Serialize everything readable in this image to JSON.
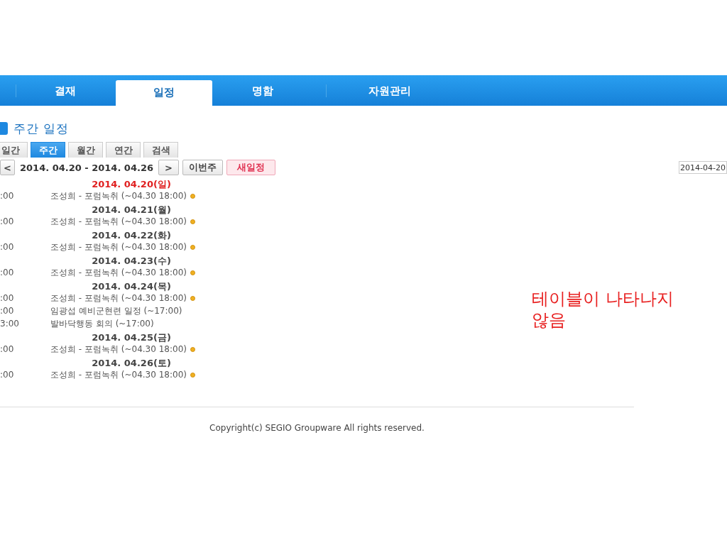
{
  "nav_tabs": [
    {
      "label": "결재",
      "selected": false
    },
    {
      "label": "일정",
      "selected": true
    },
    {
      "label": "명함",
      "selected": false
    },
    {
      "label": "자원관리",
      "selected": false
    }
  ],
  "section_title": "주간 일정",
  "view_tabs": [
    {
      "label": "일간",
      "selected": false
    },
    {
      "label": "주간",
      "selected": true
    },
    {
      "label": "월간",
      "selected": false
    },
    {
      "label": "연간",
      "selected": false
    },
    {
      "label": "검색",
      "selected": false
    }
  ],
  "toolbar": {
    "prev": "<",
    "range": "2014. 04.20 - 2014. 04.26",
    "next": ">",
    "this_week": "이번주",
    "new_event": "새일정",
    "date_value": "2014-04-20"
  },
  "days": [
    {
      "date": "2014. 04.20(일)",
      "holiday": true,
      "events": [
        {
          "time": ":00",
          "title": "조성희 - 포럼녹취 (~04.30 18:00)",
          "marker": true
        }
      ]
    },
    {
      "date": "2014. 04.21(월)",
      "holiday": false,
      "events": [
        {
          "time": ":00",
          "title": "조성희 - 포럼녹취 (~04.30 18:00)",
          "marker": true
        }
      ]
    },
    {
      "date": "2014. 04.22(화)",
      "holiday": false,
      "events": [
        {
          "time": ":00",
          "title": "조성희 - 포럼녹취 (~04.30 18:00)",
          "marker": true
        }
      ]
    },
    {
      "date": "2014. 04.23(수)",
      "holiday": false,
      "events": [
        {
          "time": ":00",
          "title": "조성희 - 포럼녹취 (~04.30 18:00)",
          "marker": true
        }
      ]
    },
    {
      "date": "2014. 04.24(목)",
      "holiday": false,
      "events": [
        {
          "time": ":00",
          "title": "조성희 - 포럼녹취 (~04.30 18:00)",
          "marker": true
        },
        {
          "time": ":00",
          "title": "임광섭 예비군현련 일정 (~17:00)",
          "marker": false
        },
        {
          "time": "3:00",
          "title": "발바닥행동 회의 (~17:00)",
          "marker": false
        }
      ]
    },
    {
      "date": "2014. 04.25(금)",
      "holiday": false,
      "events": [
        {
          "time": ":00",
          "title": "조성희 - 포럼녹취 (~04.30 18:00)",
          "marker": true
        }
      ]
    },
    {
      "date": "2014. 04.26(토)",
      "holiday": false,
      "events": [
        {
          "time": ":00",
          "title": "조성희 - 포럼녹취 (~04.30 18:00)",
          "marker": true
        }
      ]
    }
  ],
  "annotation": "테이블이 나타나지 않음",
  "footer": "Copyright(c) SEGIO Groupware All rights reserved."
}
